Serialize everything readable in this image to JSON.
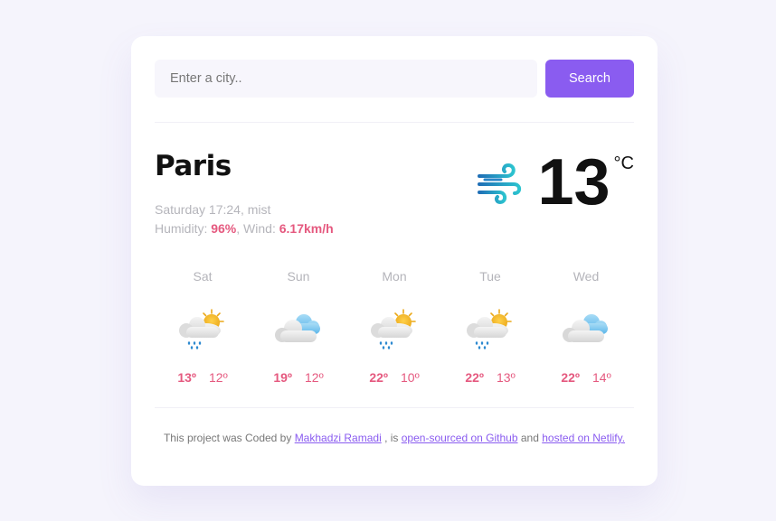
{
  "search": {
    "placeholder": "Enter a city..",
    "value": "",
    "button_label": "Search"
  },
  "current": {
    "city": "Paris",
    "datetime_desc": "Saturday 17:24, mist",
    "humidity_label": "Humidity: ",
    "humidity_value": "96%",
    "wind_label": ", Wind: ",
    "wind_value": "6.17km/h",
    "temperature": "13",
    "unit": "°C",
    "icon": "wind-icon"
  },
  "forecast": [
    {
      "day": "Sat",
      "icon": "rain-sun-icon",
      "max": "13º",
      "min": "12º"
    },
    {
      "day": "Sun",
      "icon": "cloudy-icon",
      "max": "19º",
      "min": "12º"
    },
    {
      "day": "Mon",
      "icon": "rain-sun-icon",
      "max": "22º",
      "min": "10º"
    },
    {
      "day": "Tue",
      "icon": "rain-sun-icon",
      "max": "22º",
      "min": "13º"
    },
    {
      "day": "Wed",
      "icon": "cloudy-icon",
      "max": "22º",
      "min": "14º"
    }
  ],
  "footer": {
    "text1": "This project was Coded by ",
    "author_link": "Makhadzi Ramadi",
    "text2": " , is ",
    "source_link": "open-sourced on Github",
    "text3": " and ",
    "host_link": "hosted on Netlify."
  },
  "colors": {
    "accent": "#8a5cf0",
    "highlight": "#e5597f",
    "background": "#f5f4fc"
  }
}
